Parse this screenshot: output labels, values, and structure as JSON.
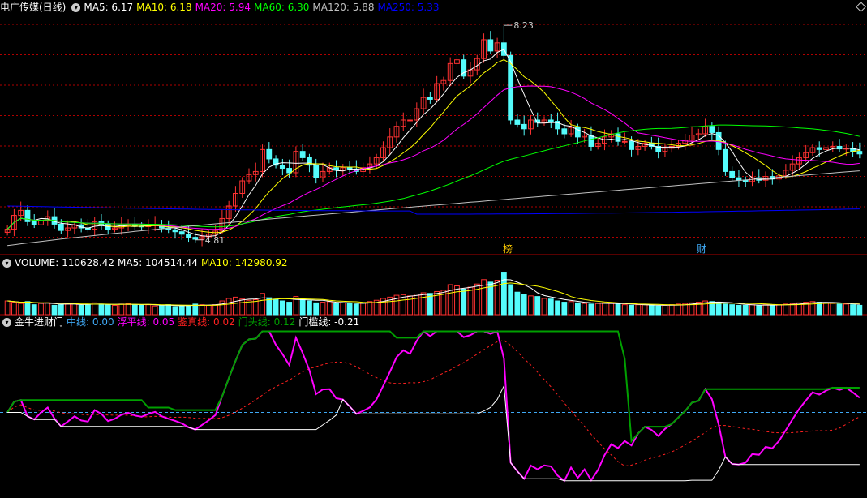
{
  "price_header": {
    "title": "电广传媒(日线)",
    "items": [
      {
        "label": "MA5: 6.17",
        "color": "#ffffff"
      },
      {
        "label": "MA10: 6.18",
        "color": "#ffff00"
      },
      {
        "label": "MA20: 5.94",
        "color": "#ff00ff"
      },
      {
        "label": "MA60: 6.30",
        "color": "#00ff00"
      },
      {
        "label": "MA120: 5.88",
        "color": "#c0c0c0"
      },
      {
        "label": "MA250: 5.33",
        "color": "#0000ff"
      }
    ]
  },
  "volume_header": {
    "title": "VOLUME: 110628.42",
    "items": [
      {
        "label": "MA5: 104514.44",
        "color": "#ffffff"
      },
      {
        "label": "MA10: 142980.92",
        "color": "#ffff00"
      }
    ]
  },
  "indicator_header": {
    "title": "金牛进财门",
    "items": [
      {
        "label": "中线: 0.00",
        "color": "#3fa9f5"
      },
      {
        "label": "浮平线: 0.05",
        "color": "#ff00ff"
      },
      {
        "label": "鉴真线: 0.02",
        "color": "#ff2020"
      },
      {
        "label": "门头线: 0.12",
        "color": "#00a000"
      },
      {
        "label": "门槛线: -0.21",
        "color": "#ffffff"
      }
    ]
  },
  "colors": {
    "up": "#ff3232",
    "down": "#54fcfc",
    "grid": "#b00000",
    "axis": "#b00000"
  },
  "markers": {
    "high": "8.23",
    "low": "4.81",
    "tag1": "榜",
    "tag2": "财"
  },
  "chart_data": {
    "type": "candlestick",
    "close": [
      4.98,
      5.2,
      5.28,
      5.1,
      5.05,
      5.12,
      5.18,
      5.06,
      4.96,
      5,
      5.05,
      5.0,
      4.98,
      5.1,
      5.06,
      4.98,
      5.0,
      5.04,
      5.06,
      5.03,
      5.02,
      5.04,
      5.05,
      5.0,
      4.97,
      4.94,
      4.9,
      4.85,
      4.82,
      4.86,
      4.9,
      4.95,
      5.15,
      5.35,
      5.55,
      5.75,
      5.85,
      5.9,
      6.25,
      6.1,
      6.0,
      5.95,
      5.88,
      6.22,
      6.12,
      6.0,
      5.8,
      5.9,
      5.96,
      5.92,
      5.96,
      5.94,
      5.9,
      5.96,
      6.02,
      6.12,
      6.28,
      6.45,
      6.62,
      6.72,
      6.72,
      6.9,
      7.08,
      7.05,
      7.3,
      7.35,
      7.62,
      7.68,
      7.42,
      7.52,
      7.7,
      8.0,
      7.82,
      7.95,
      7.75,
      6.72,
      6.65,
      6.58,
      6.72,
      6.68,
      6.72,
      6.7,
      6.58,
      6.5,
      6.6,
      6.45,
      6.48,
      6.3,
      6.35,
      6.45,
      6.5,
      6.38,
      6.38,
      6.25,
      6.3,
      6.35,
      6.3,
      6.22,
      6.27,
      6.3,
      6.35,
      6.4,
      6.48,
      6.5,
      6.62,
      6.52,
      6.25,
      5.9,
      5.8,
      5.76,
      5.74,
      5.8,
      5.76,
      5.82,
      5.78,
      5.83,
      5.92,
      6.02,
      6.12,
      6.2,
      6.28,
      6.25,
      6.28,
      6.3,
      6.26,
      6.27,
      6.22,
      6.18
    ],
    "ma_series": [
      "MA5",
      "MA10",
      "MA20",
      "MA60",
      "MA120",
      "MA250"
    ],
    "volume": [
      2.2,
      2.0,
      1.8,
      2.1,
      1.6,
      1.8,
      1.9,
      1.5,
      1.6,
      1.7,
      1.8,
      1.5,
      1.6,
      1.9,
      1.7,
      1.6,
      1.5,
      1.7,
      1.8,
      1.6,
      1.5,
      1.6,
      1.4,
      1.5,
      1.6,
      1.3,
      1.4,
      1.5,
      1.7,
      1.6,
      1.5,
      1.6,
      2.2,
      2.6,
      2.8,
      2.5,
      2.3,
      2.4,
      3.4,
      2.7,
      2.4,
      2.2,
      2.0,
      2.9,
      2.5,
      2.2,
      1.9,
      2.0,
      2.1,
      1.8,
      1.9,
      1.8,
      1.7,
      1.9,
      2.1,
      2.3,
      2.6,
      2.8,
      3.1,
      3.2,
      3.0,
      3.3,
      3.5,
      3.4,
      3.7,
      3.9,
      4.8,
      4.6,
      4.1,
      4.4,
      4.9,
      5.6,
      5.2,
      5.5,
      6.8,
      4.8,
      3.6,
      3.2,
      3.0,
      2.9,
      2.6,
      2.5,
      2.2,
      2.0,
      2.1,
      1.9,
      1.8,
      1.7,
      1.8,
      1.9,
      1.8,
      1.7,
      1.6,
      1.5,
      1.6,
      1.6,
      1.5,
      1.4,
      1.5,
      1.6,
      1.7,
      1.8,
      1.9,
      2.0,
      2.2,
      2.1,
      1.9,
      1.7,
      1.6,
      1.5,
      1.5,
      1.6,
      1.5,
      1.6,
      1.5,
      1.6,
      1.7,
      1.8,
      1.9,
      2.0,
      2.1,
      2.0,
      1.9,
      1.8,
      1.7,
      1.7,
      1.6,
      1.5
    ],
    "indicator": {
      "lines": [
        "中线",
        "浮平线",
        "鉴真线",
        "门头线",
        "门槛线"
      ]
    }
  }
}
